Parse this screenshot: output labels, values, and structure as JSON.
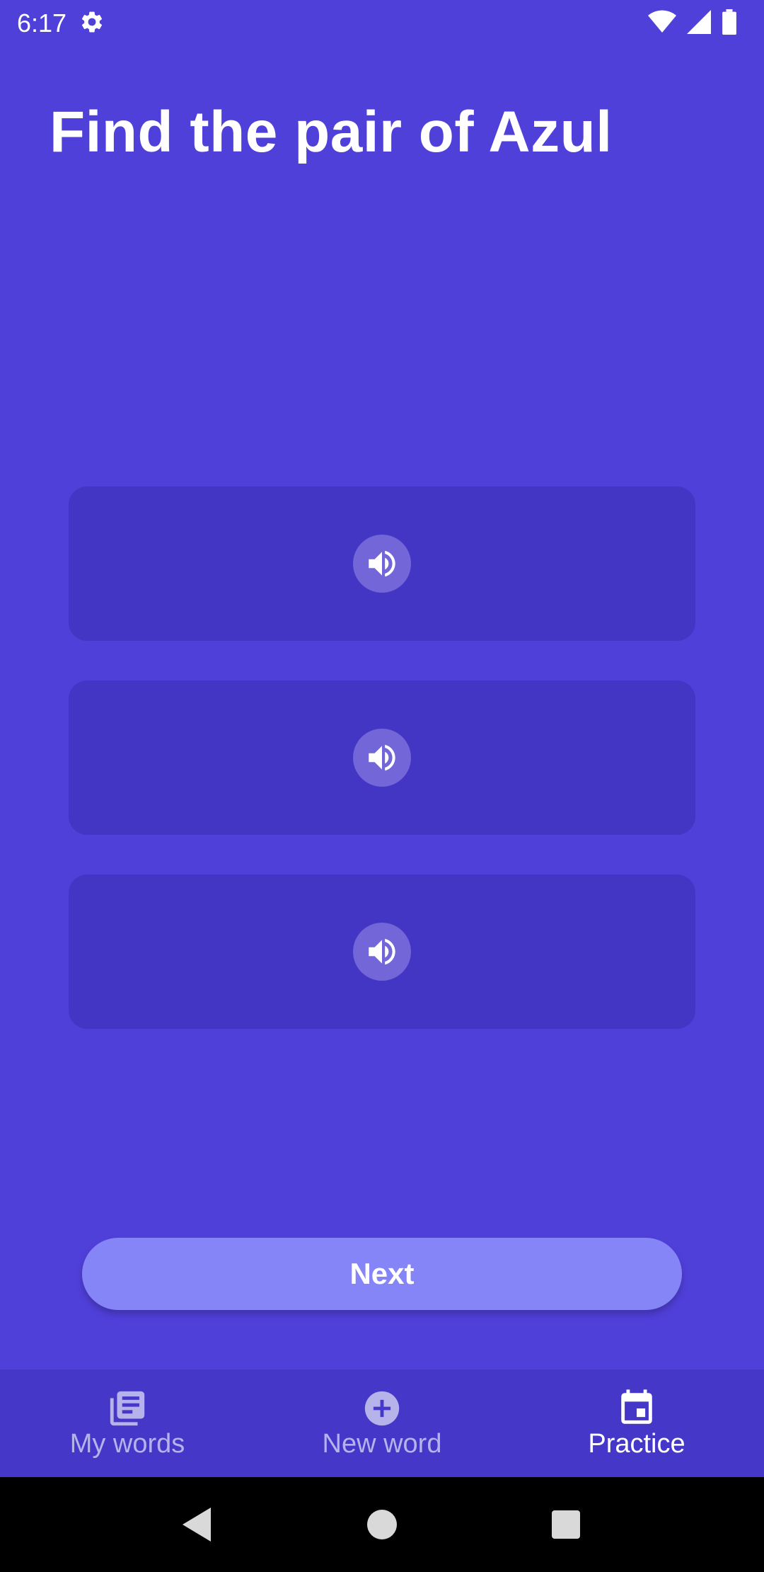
{
  "status_bar": {
    "time": "6:17",
    "icons": [
      "settings-icon",
      "wifi-icon",
      "signal-icon",
      "battery-icon"
    ]
  },
  "title": "Find the pair of Azul",
  "options": [
    {
      "icon": "speaker-icon"
    },
    {
      "icon": "speaker-icon"
    },
    {
      "icon": "speaker-icon"
    }
  ],
  "next_button": {
    "label": "Next"
  },
  "bottom_nav": {
    "items": [
      {
        "label": "My words",
        "icon": "list-icon",
        "active": false
      },
      {
        "label": "New word",
        "icon": "add-circle-icon",
        "active": false
      },
      {
        "label": "Practice",
        "icon": "calendar-icon",
        "active": true
      }
    ]
  },
  "system_nav": {
    "buttons": [
      "back-icon",
      "home-icon",
      "recents-icon"
    ]
  },
  "colors": {
    "background": "#5040da",
    "card": "#4336c4",
    "button": "#8585f8",
    "nav_bar": "#4538c8"
  }
}
